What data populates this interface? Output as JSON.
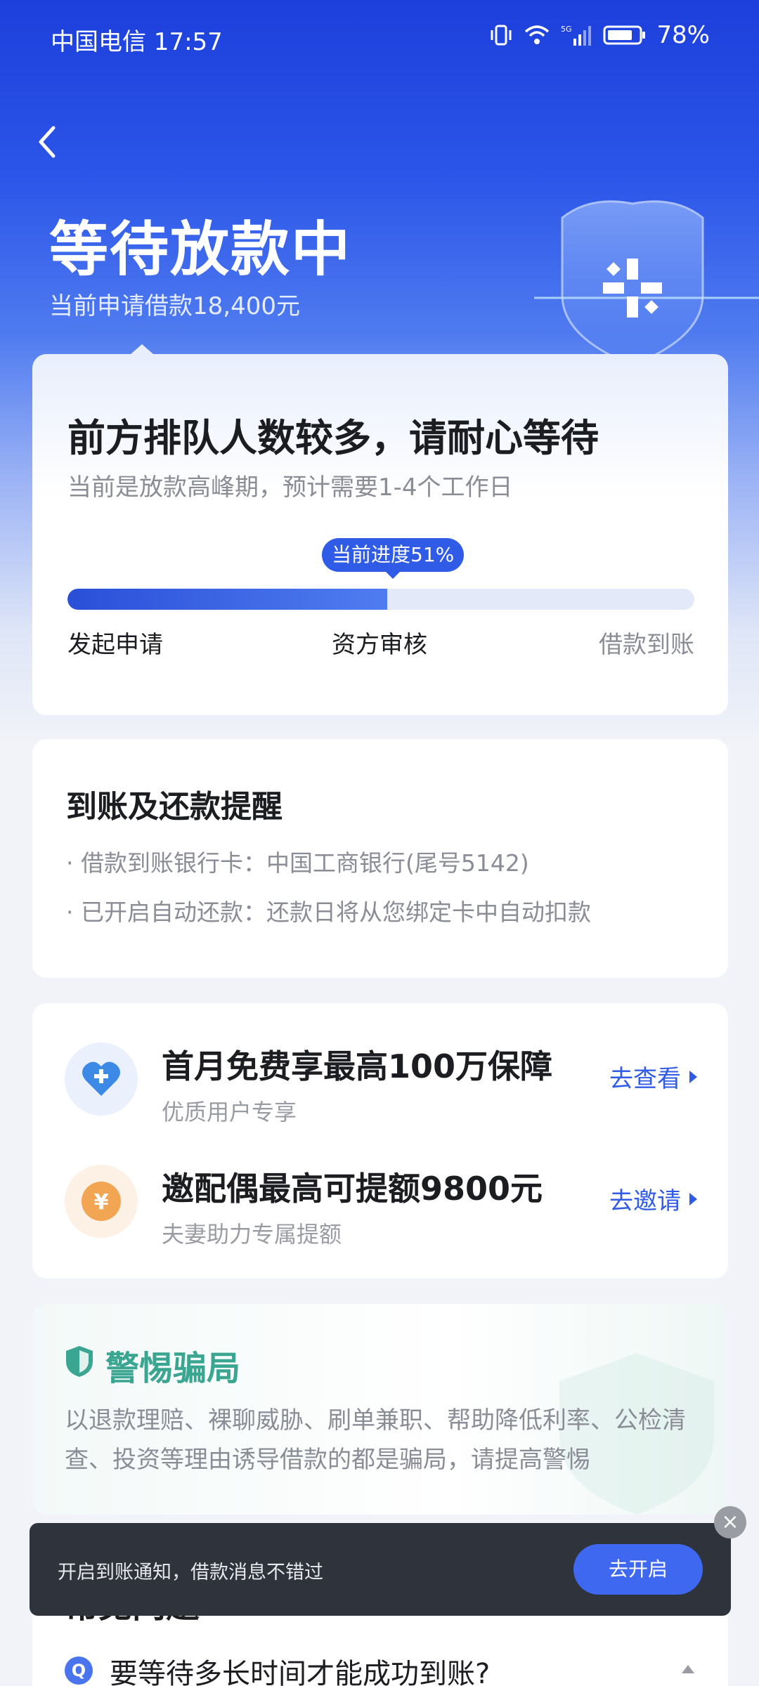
{
  "status_bar": {
    "carrier_time": "中国电信 17:57",
    "battery": "78%",
    "icons": [
      "vibrate-icon",
      "wifi-icon",
      "signal-5g-icon",
      "battery-icon"
    ]
  },
  "header": {
    "title": "等待放款中",
    "subtitle": "当前申请借款18,400元"
  },
  "progress_card": {
    "title": "前方排队人数较多，请耐心等待",
    "subtitle": "当前是放款高峰期，预计需要1-4个工作日",
    "badge": "当前进度51%",
    "progress": 0.51,
    "steps": [
      "发起申请",
      "资方审核",
      "借款到账"
    ]
  },
  "reminder_card": {
    "title": "到账及还款提醒",
    "lines": [
      "· 借款到账银行卡：中国工商银行(尾号5142)",
      "· 已开启自动还款：还款日将从您绑定卡中自动扣款"
    ]
  },
  "promo_card": {
    "items": [
      {
        "title": "首月免费享最高100万保障",
        "desc": "优质用户专享",
        "link": "去查看",
        "icon": "heart-plus-icon"
      },
      {
        "title": "邀配偶最高可提额9800元",
        "desc": "夫妻助力专属提额",
        "link": "去邀请",
        "icon": "yuan-coin-icon"
      }
    ]
  },
  "warning_card": {
    "title": "警惕骗局",
    "text": "以退款理赔、裸聊威胁、刷单兼职、帮助降低利率、公检清查、投资等理由诱导借款的都是骗局，请提高警惕"
  },
  "faq": {
    "heading": "常见问题",
    "question_icon": "Q",
    "question": "要等待多长时间才能成功到账?"
  },
  "toast": {
    "text": "开启到账通知，借款消息不错过",
    "button": "去开启",
    "close": "×"
  },
  "colors": {
    "brand_blue": "#2f5be6",
    "warning_green": "#3aa590",
    "toast_bg": "#2f333b"
  }
}
